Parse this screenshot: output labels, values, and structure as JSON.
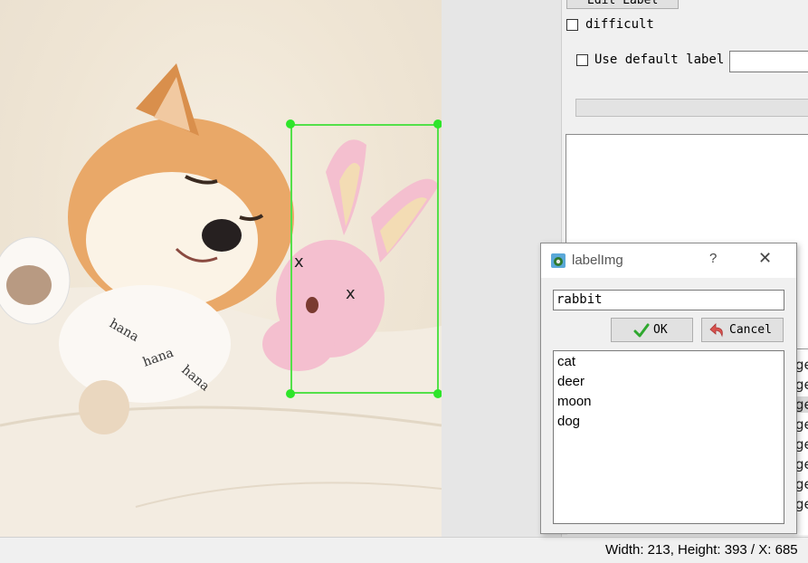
{
  "toolbar": {
    "edit_label_button": "Edit Label"
  },
  "options": {
    "difficult_label": "difficult",
    "difficult_checked": false,
    "use_default_label": "Use default label",
    "use_default_checked": false,
    "default_label_value": ""
  },
  "canvas": {
    "box_color": "#54e04a"
  },
  "file_list": {
    "rows": [
      "ge",
      "ge",
      "ge",
      "ge",
      "ge",
      "ge",
      "ge",
      "ge"
    ]
  },
  "status_bar": {
    "text": "Width: 213, Height: 393 / X: 685"
  },
  "dialog": {
    "title": "labelImg",
    "help": "?",
    "close": "✕",
    "input_value": "rabbit",
    "ok_label": "OK",
    "cancel_label": "Cancel",
    "suggestions": [
      "cat",
      "deer",
      "moon",
      "dog"
    ]
  }
}
